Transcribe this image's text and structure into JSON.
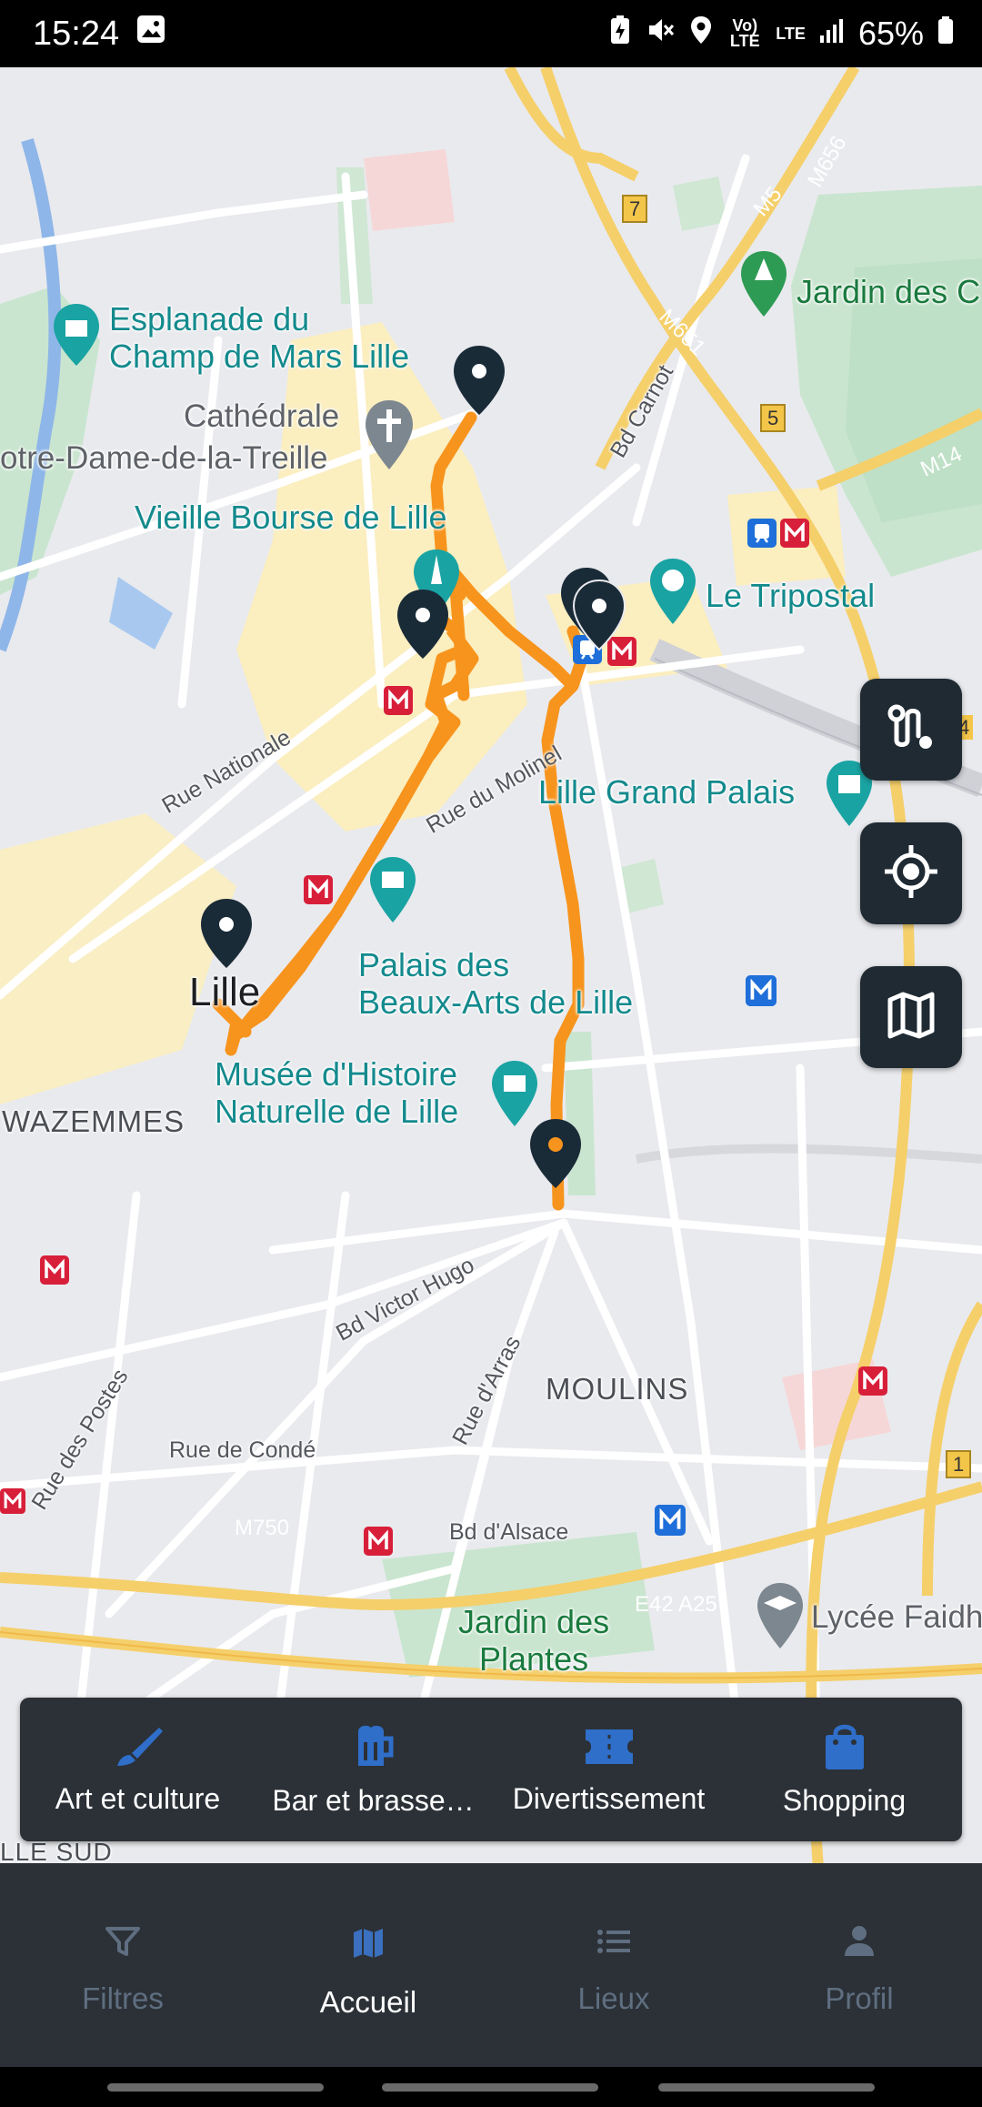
{
  "status_bar": {
    "time": "15:24",
    "battery": "65%",
    "net1": "Vo) LTE",
    "net2": "LTE"
  },
  "map": {
    "labels": {
      "esplanade": "Esplanade du\nChamp de Mars Lille",
      "cathedrale1": "Cathédrale",
      "cathedrale2": "otre-Dame-de-la-Treille",
      "vieille_bourse": "Vieille Bourse de Lille",
      "tripostal": "Le Tripostal",
      "grand_palais": "Lille Grand Palais",
      "palais_beaux_arts": "Palais des\nBeaux-Arts de Lille",
      "musee_histoire": "Musée d'Histoire\nNaturelle de Lille",
      "jardin_top": "Jardin des C",
      "jardin_plantes": "Jardin des\nPlantes",
      "lycee": "Lycée Faidh",
      "city": "Lille",
      "wazemmes": "WAZEMMES",
      "moulins": "MOULINS",
      "lille_sud": "LLE SUD",
      "rue_nationale": "Rue Nationale",
      "rue_molinel": "Rue du Molinel",
      "bd_carnot": "Bd Carnot",
      "bd_victor_hugo": "Bd Victor Hugo",
      "rue_arras": "Rue d'Arras",
      "rue_postes": "Rue des Postes",
      "rue_conde": "Rue de Condé",
      "bd_alsace": "Bd d'Alsace",
      "m750": "M750",
      "m651": "M651",
      "m656": "M656",
      "m14": "M14",
      "e42": "E42 A25",
      "m5": "M5",
      "shield7": "7",
      "shield5": "5",
      "shield1": "1",
      "shield4": "4"
    },
    "accent_route": "#f7941d",
    "marker_color": "#1a2b38"
  },
  "side_buttons": {
    "route": "route-icon",
    "locate": "locate-icon",
    "layers": "map-icon"
  },
  "categories": [
    {
      "label": "Art et culture",
      "icon": "brush-icon"
    },
    {
      "label": "Bar et brasse…",
      "icon": "beer-icon"
    },
    {
      "label": "Divertissement",
      "icon": "ticket-icon"
    },
    {
      "label": "Shopping",
      "icon": "shopping-bag-icon"
    }
  ],
  "bottom_nav": [
    {
      "label": "Filtres",
      "icon": "filter-icon",
      "active": false
    },
    {
      "label": "Accueil",
      "icon": "map-icon",
      "active": true
    },
    {
      "label": "Lieux",
      "icon": "list-icon",
      "active": false
    },
    {
      "label": "Profil",
      "icon": "person-icon",
      "active": false
    }
  ]
}
